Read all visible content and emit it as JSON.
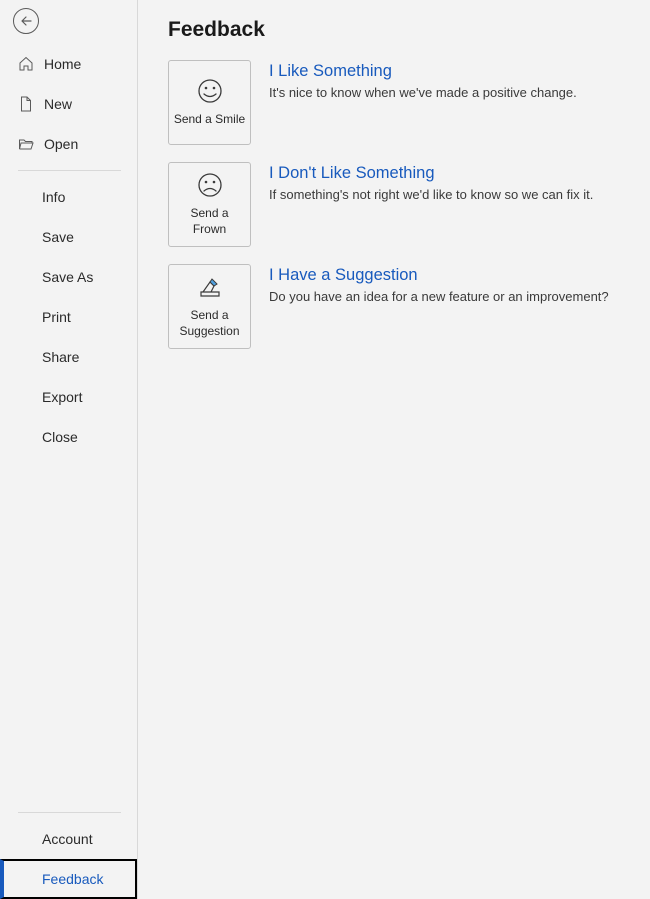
{
  "sidebar": {
    "nav1": [
      {
        "label": "Home"
      },
      {
        "label": "New"
      },
      {
        "label": "Open"
      }
    ],
    "nav2": [
      {
        "label": "Info"
      },
      {
        "label": "Save"
      },
      {
        "label": "Save As"
      },
      {
        "label": "Print"
      },
      {
        "label": "Share"
      },
      {
        "label": "Export"
      },
      {
        "label": "Close"
      }
    ],
    "bottom": [
      {
        "label": "Account"
      },
      {
        "label": "Feedback"
      }
    ]
  },
  "page": {
    "title": "Feedback",
    "options": [
      {
        "tile_label": "Send a Smile",
        "title": "I Like Something",
        "desc": "It's nice to know when we've made a positive change."
      },
      {
        "tile_label": "Send a Frown",
        "title": "I Don't Like Something",
        "desc": "If something's not right we'd like to know so we can fix it."
      },
      {
        "tile_label": "Send a Suggestion",
        "title": "I Have a Suggestion",
        "desc": "Do you have an idea for a new feature or an improvement?"
      }
    ]
  }
}
